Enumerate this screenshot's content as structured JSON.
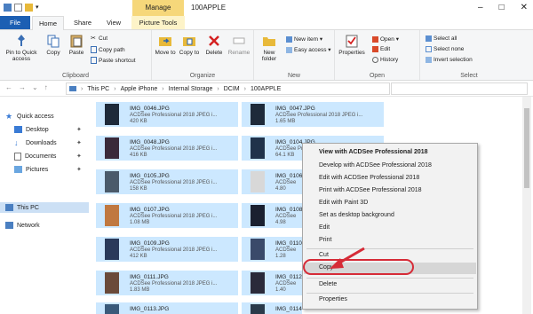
{
  "window": {
    "title": "100APPLE",
    "context_tab": "Manage",
    "controls": [
      "–",
      "□",
      "✕"
    ]
  },
  "tabs": [
    "File",
    "Home",
    "Share",
    "View",
    "Picture Tools"
  ],
  "ribbon": {
    "clipboard": {
      "label": "Clipboard",
      "pin": "Pin to Quick access",
      "copy": "Copy",
      "paste": "Paste",
      "cut": "Cut",
      "copy_path": "Copy path",
      "paste_shortcut": "Paste shortcut"
    },
    "organize": {
      "label": "Organize",
      "move_to": "Move to",
      "copy_to": "Copy to",
      "delete": "Delete",
      "rename": "Rename"
    },
    "new": {
      "label": "New",
      "new_folder": "New folder",
      "new_item": "New item ▾",
      "easy_access": "Easy access ▾"
    },
    "open": {
      "label": "Open",
      "properties": "Properties",
      "open": "Open ▾",
      "edit": "Edit",
      "history": "History"
    },
    "select": {
      "label": "Select",
      "select_all": "Select all",
      "select_none": "Select none",
      "invert": "Invert selection"
    }
  },
  "address": {
    "crumbs": [
      "This PC",
      "Apple iPhone",
      "Internal Storage",
      "DCIM",
      "100APPLE"
    ]
  },
  "nav": {
    "quick_access": "Quick access",
    "desktop": "Desktop",
    "downloads": "Downloads",
    "documents": "Documents",
    "pictures": "Pictures",
    "this_pc": "This PC",
    "network": "Network"
  },
  "files": [
    {
      "name": "IMG_0046.JPG",
      "app": "ACDSee Professional 2018 JPEG i...",
      "size": "420 KB"
    },
    {
      "name": "IMG_0047.JPG",
      "app": "ACDSee Professional 2018 JPEG i...",
      "size": "1.65 MB"
    },
    {
      "name": "IMG_0048.JPG",
      "app": "ACDSee Professional 2018 JPEG i...",
      "size": "416 KB"
    },
    {
      "name": "IMG_0104.JPG",
      "app": "ACDSee Professional 2018 JPEG i...",
      "size": "64.1 KB"
    },
    {
      "name": "IMG_0105.JPG",
      "app": "ACDSee Professional 2018 JPEG i...",
      "size": "158 KB"
    },
    {
      "name": "IMG_0106",
      "app": "ACDSee",
      "size": "4.80"
    },
    {
      "name": "IMG_0107.JPG",
      "app": "ACDSee Professional 2018 JPEG i...",
      "size": "1.08 MB"
    },
    {
      "name": "IMG_0108",
      "app": "ACDSee",
      "size": "4.98"
    },
    {
      "name": "IMG_0109.JPG",
      "app": "ACDSee Professional 2018 JPEG i...",
      "size": "412 KB"
    },
    {
      "name": "IMG_0110",
      "app": "ACDSee",
      "size": "1.28"
    },
    {
      "name": "IMG_0111.JPG",
      "app": "ACDSee Professional 2018 JPEG i...",
      "size": "1.83 MB"
    },
    {
      "name": "IMG_0112",
      "app": "ACDSee",
      "size": "1.40"
    },
    {
      "name": "IMG_0113.JPG",
      "app": "ACDSee Professional 2018 JPEG i...",
      "size": ""
    },
    {
      "name": "IMG_0114",
      "app": "ACDSee",
      "size": ""
    }
  ],
  "context_menu": {
    "view_with": "View with ACDSee Professional 2018",
    "develop_with": "Develop with ACDSee Professional 2018",
    "edit_with": "Edit with ACDSee Professional 2018",
    "print_with": "Print with ACDSee Professional 2018",
    "edit_paint3d": "Edit with Paint 3D",
    "set_bg": "Set as desktop background",
    "edit": "Edit",
    "print": "Print",
    "cut": "Cut",
    "copy": "Copy",
    "delete": "Delete",
    "properties": "Properties"
  },
  "colors": {
    "accent": "#1c5fb3",
    "selection": "#cce8ff",
    "highlight_ring": "#d62b37",
    "manage_tab": "#f6d77a"
  }
}
